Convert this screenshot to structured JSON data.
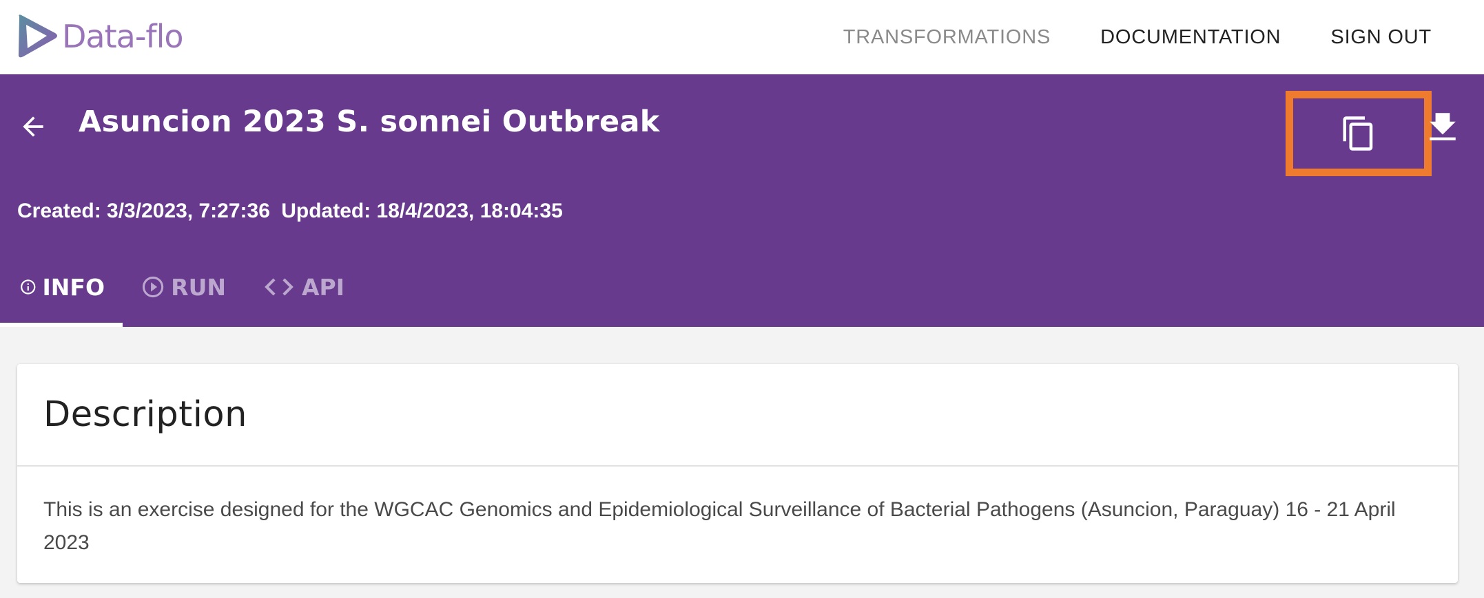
{
  "app": {
    "logo_text": "Data-flo",
    "logo_colors": {
      "gradient_start": "#5b8fa0",
      "gradient_end": "#8a5ab0",
      "text": "#9a74b9"
    }
  },
  "topnav": {
    "links": [
      {
        "label": "TRANSFORMATIONS",
        "style": "muted"
      },
      {
        "label": "DOCUMENTATION",
        "style": "dark"
      },
      {
        "label": "SIGN OUT",
        "style": "dark"
      }
    ]
  },
  "header": {
    "background": "#673a8e",
    "title": "Asuncion 2023 S. sonnei Outbreak",
    "created": "Created: 3/3/2023, 7:27:36",
    "updated": "Updated: 18/4/2023, 18:04:35",
    "actions": {
      "copy_icon": "copy-icon",
      "download_icon": "download-icon",
      "highlight_color": "#ef7c2e"
    }
  },
  "tabs": [
    {
      "label": "INFO",
      "icon": "info-icon",
      "active": true
    },
    {
      "label": "RUN",
      "icon": "play-circle-icon",
      "active": false
    },
    {
      "label": "API",
      "icon": "code-icon",
      "active": false
    }
  ],
  "card": {
    "title": "Description",
    "body": "This is an exercise designed for the WGCAC Genomics and Epidemiological Surveillance of Bacterial Pathogens (Asuncion, Paraguay) 16 - 21 April 2023"
  }
}
